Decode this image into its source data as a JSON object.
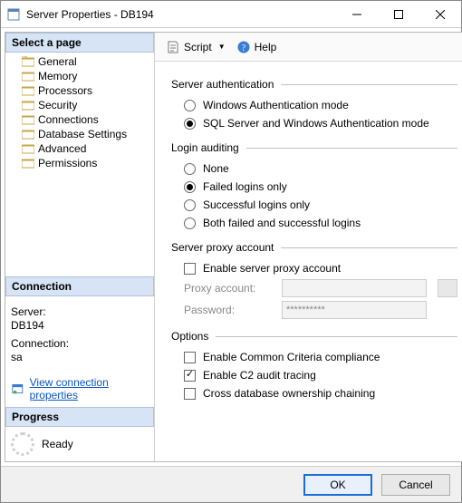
{
  "window": {
    "title": "Server Properties - DB194"
  },
  "left": {
    "select_page_header": "Select a page",
    "pages": [
      "General",
      "Memory",
      "Processors",
      "Security",
      "Connections",
      "Database Settings",
      "Advanced",
      "Permissions"
    ],
    "connection_header": "Connection",
    "server_label": "Server:",
    "server_value": "DB194",
    "connection_label": "Connection:",
    "connection_value": "sa",
    "view_props_link": "View connection properties",
    "progress_header": "Progress",
    "progress_status": "Ready"
  },
  "toolbar": {
    "script": "Script",
    "help": "Help"
  },
  "groups": {
    "auth": {
      "title": "Server authentication",
      "opt_windows": "Windows Authentication mode",
      "opt_sql_windows": "SQL Server and Windows Authentication mode"
    },
    "audit": {
      "title": "Login auditing",
      "opt_none": "None",
      "opt_failed": "Failed logins only",
      "opt_success": "Successful logins only",
      "opt_both": "Both failed and successful logins"
    },
    "proxy": {
      "title": "Server proxy account",
      "enable": "Enable server proxy account",
      "account_label": "Proxy account:",
      "account_value": "",
      "password_label": "Password:",
      "password_value": "**********"
    },
    "options": {
      "title": "Options",
      "common_criteria": "Enable Common Criteria compliance",
      "c2_audit": "Enable C2 audit tracing",
      "cross_db": "Cross database ownership chaining"
    }
  },
  "footer": {
    "ok": "OK",
    "cancel": "Cancel"
  }
}
